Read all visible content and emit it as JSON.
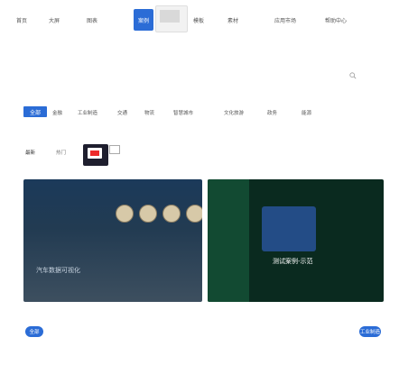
{
  "nav": {
    "items": [
      "首页",
      "大屏",
      "图表",
      "模板",
      "素材",
      "应用市场",
      "帮助中心"
    ],
    "active_label": "案例"
  },
  "categories": {
    "badge": "全部",
    "items": [
      "金融",
      "工业制造",
      "交通",
      "物流",
      "智慧城市",
      "文化旅游",
      "政务",
      "能源"
    ]
  },
  "filters": [
    "最新",
    "热门"
  ],
  "cards": [
    {
      "title": "汽车数据可视化"
    },
    {
      "title": "测试案例-示范"
    }
  ],
  "badges": {
    "left": "全部",
    "right": "工业制造"
  },
  "colors": {
    "accent": "#2b6cd6"
  }
}
